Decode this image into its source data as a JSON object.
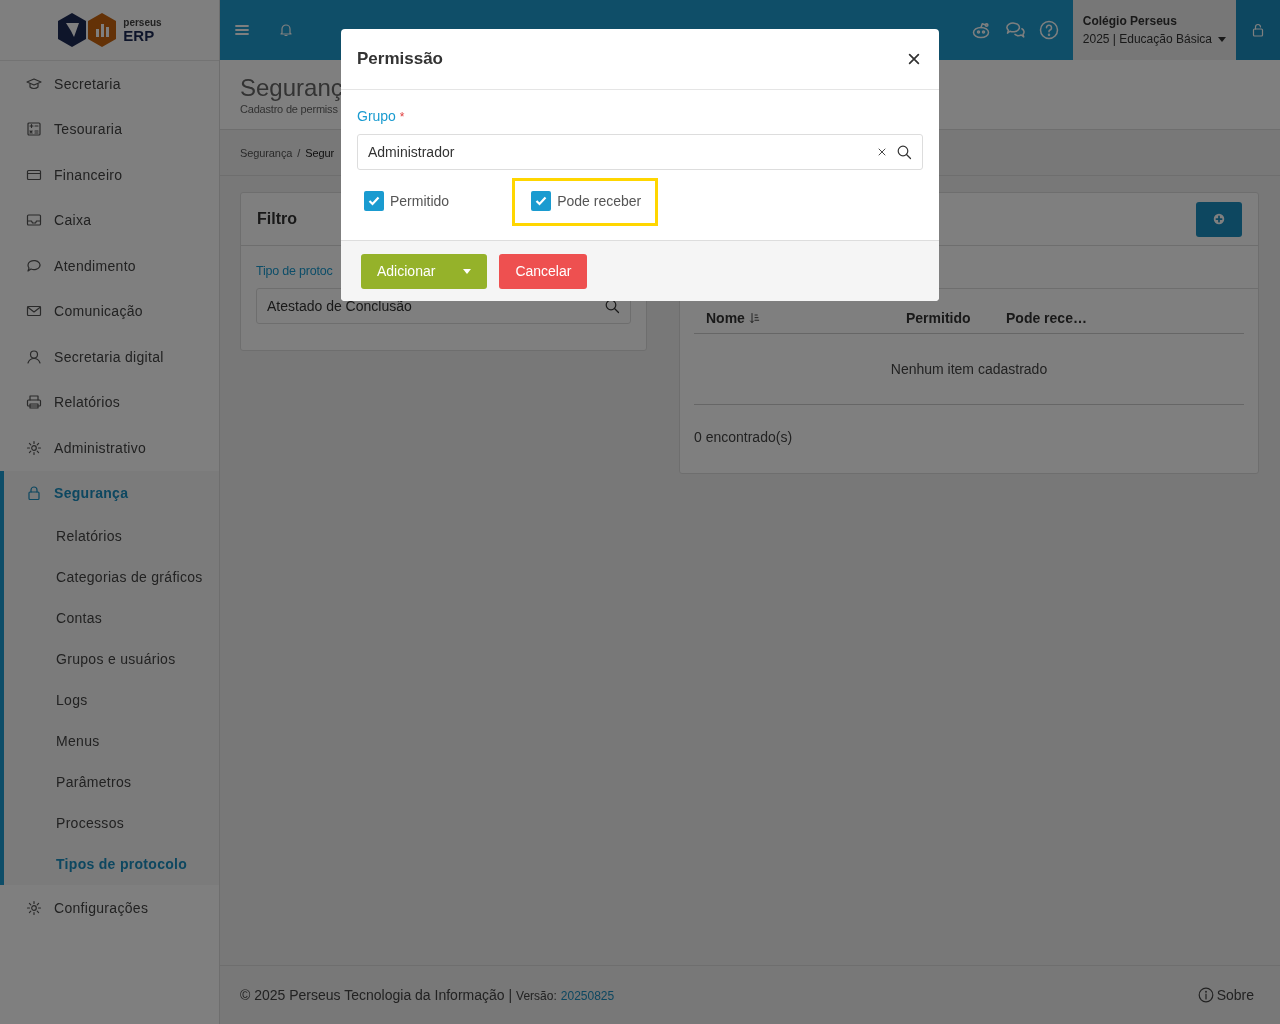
{
  "brand": {
    "logo_small": "perseus",
    "logo_large": "ERP"
  },
  "topbar": {
    "school": "Colégio Perseus",
    "context": "2025 | Educação Básica"
  },
  "sidebar": {
    "items": [
      {
        "label": "Secretaria",
        "selected": false
      },
      {
        "label": "Tesouraria",
        "selected": false
      },
      {
        "label": "Financeiro",
        "selected": false
      },
      {
        "label": "Caixa",
        "selected": false
      },
      {
        "label": "Atendimento",
        "selected": false
      },
      {
        "label": "Comunicação",
        "selected": false
      },
      {
        "label": "Secretaria digital",
        "selected": false
      },
      {
        "label": "Relatórios",
        "selected": false
      },
      {
        "label": "Administrativo",
        "selected": false
      },
      {
        "label": "Segurança",
        "selected": true,
        "children": [
          {
            "label": "Relatórios",
            "selected": false
          },
          {
            "label": "Categorias de gráficos",
            "selected": false
          },
          {
            "label": "Contas",
            "selected": false
          },
          {
            "label": "Grupos e usuários",
            "selected": false
          },
          {
            "label": "Logs",
            "selected": false
          },
          {
            "label": "Menus",
            "selected": false
          },
          {
            "label": "Parâmetros",
            "selected": false
          },
          {
            "label": "Processos",
            "selected": false
          },
          {
            "label": "Tipos de protocolo",
            "selected": true
          }
        ]
      },
      {
        "label": "Configurações",
        "selected": false
      }
    ]
  },
  "page": {
    "title": "Seguranç",
    "subtitle": "Cadastro de permiss",
    "breadcrumb": [
      "Segurança",
      "Segur"
    ],
    "breadcrumb_separator": "/"
  },
  "filter": {
    "title": "Filtro",
    "field_label": "Tipo de protoc",
    "field_value": "Atestado de Conclusão"
  },
  "results": {
    "columns": [
      "Nome",
      "Permitido",
      "Pode rece…"
    ],
    "empty": "Nenhum item cadastrado",
    "count": "0 encontrado(s)"
  },
  "footer": {
    "copyright": "© 2025 Perseus Tecnologia da Informação |",
    "version_label": "Versão:",
    "version": "20250825",
    "about": "Sobre"
  },
  "modal": {
    "title": "Permissão",
    "field_label": "Grupo",
    "required_mark": "*",
    "field_value": "Administrador",
    "checkboxes": [
      {
        "label": "Permitido",
        "checked": true,
        "highlighted": false
      },
      {
        "label": "Pode receber",
        "checked": true,
        "highlighted": true
      }
    ],
    "buttons": [
      {
        "kind": "primary",
        "label": "Adicionar"
      },
      {
        "kind": "cancel",
        "label": "Cancelar"
      }
    ]
  }
}
